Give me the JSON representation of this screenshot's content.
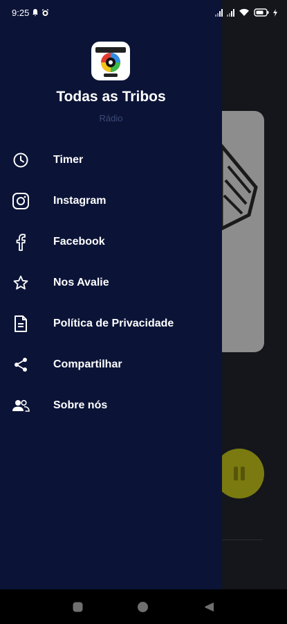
{
  "status_bar": {
    "time": "9:25"
  },
  "drawer": {
    "title": "Todas as Tribos",
    "subtitle": "Rádio",
    "items": [
      {
        "label": "Timer",
        "icon": "clock-icon"
      },
      {
        "label": "Instagram",
        "icon": "instagram-icon"
      },
      {
        "label": "Facebook",
        "icon": "facebook-icon"
      },
      {
        "label": "Nos Avalie",
        "icon": "star-icon"
      },
      {
        "label": "Política de Privacidade",
        "icon": "document-icon"
      },
      {
        "label": "Compartilhar",
        "icon": "share-icon"
      },
      {
        "label": "Sobre nós",
        "icon": "people-icon"
      }
    ]
  },
  "colors": {
    "drawer_bg": "#0b1437",
    "subtitle": "#3d4a78",
    "play_button": "#7a7a10"
  }
}
